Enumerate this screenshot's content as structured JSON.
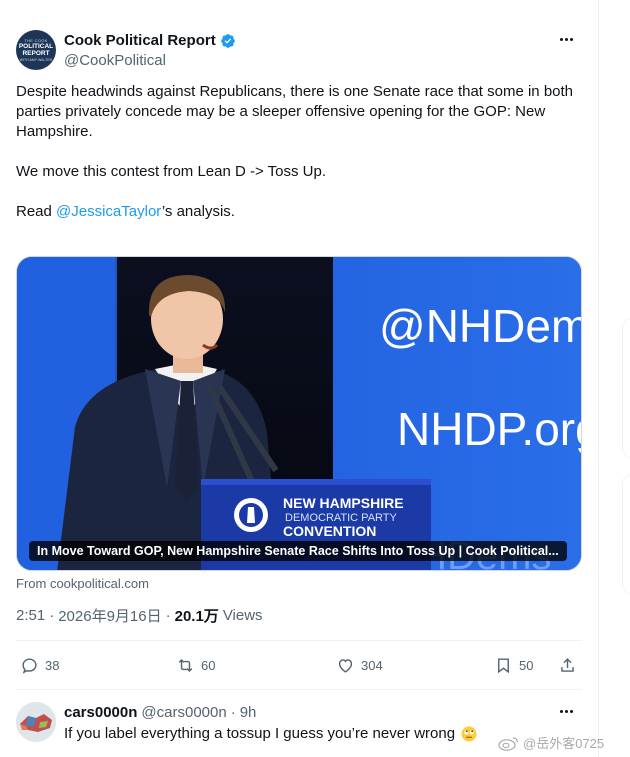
{
  "tweet": {
    "author_name": "Cook Political Report",
    "author_handle": "@CookPolitical",
    "avatar_text": [
      "THE COOK",
      "POLITICAL",
      "REPORT",
      "WITH AMY WALTER"
    ],
    "text_line1": "Despite headwinds against Republicans, there is one Senate race that some in both parties privately concede may be a sleeper offensive opening for the GOP: New Hampshire.",
    "text_line2": "We move this contest from Lean D  -> Toss Up.",
    "text_read_prefix": "Read ",
    "text_mention": "@JessicaTaylor",
    "text_read_suffix": "’s analysis.",
    "card": {
      "title": "In Move Toward GOP, New Hampshire Senate Race Shifts Into Toss Up | Cook Political...",
      "source": "From cookpolitical.com",
      "backdrop_text_1": "@NHDems",
      "backdrop_text_2": "NHDP.org",
      "backdrop_text_3": "#NHDems",
      "podium_line1": "NEW HAMPSHIRE",
      "podium_line2": "DEMOCRATIC PARTY",
      "podium_line3": "CONVENTION"
    },
    "time": "2:51",
    "separator": "·",
    "date": "2026年9月16日",
    "views_count": "20.1万",
    "views_label": "Views",
    "actions": {
      "replies": "38",
      "retweets": "60",
      "likes": "304",
      "bookmarks": "50"
    },
    "colors": {
      "link": "#1d9bf0",
      "secondary_text": "#536471",
      "verified": "#1d9bf0"
    }
  },
  "reply": {
    "name": "cars0000n",
    "handle": "@cars0000n",
    "separator": "·",
    "time": "9h",
    "text": "If you label everything a tossup I guess you’re never wrong"
  },
  "watermark": {
    "text": "@岳外客0725"
  }
}
